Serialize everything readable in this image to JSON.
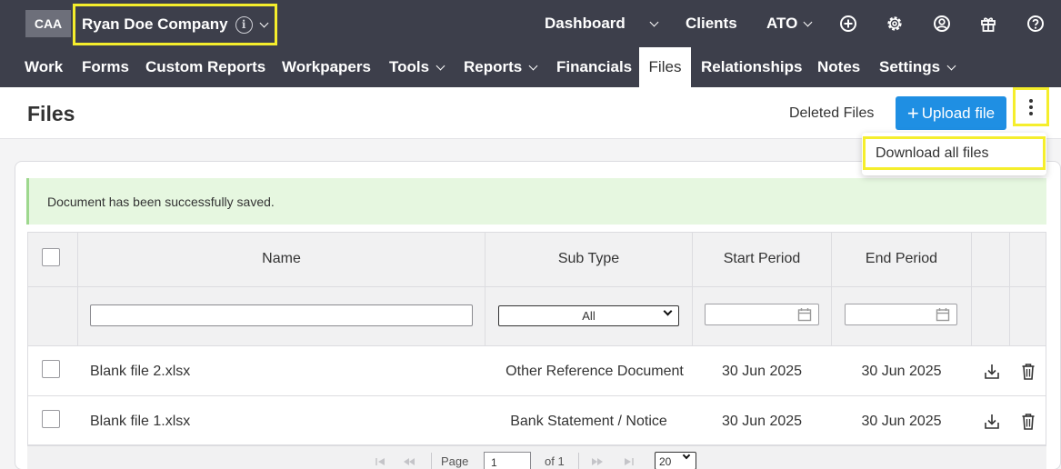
{
  "topbar": {
    "logo": "CAA",
    "company": "Ryan Doe Company",
    "company_info_glyph": "i",
    "dashboard": "Dashboard",
    "clients": "Clients",
    "ato": "ATO",
    "icons": [
      "plus-circle-icon",
      "gear-icon",
      "user-circle-icon",
      "gift-icon",
      "help-icon"
    ]
  },
  "nav": {
    "items": [
      {
        "label": "Work"
      },
      {
        "label": "Forms"
      },
      {
        "label": "Custom Reports"
      },
      {
        "label": "Workpapers"
      },
      {
        "label": "Tools"
      },
      {
        "label": "Reports"
      },
      {
        "label": "Financials"
      },
      {
        "label": "Files",
        "active": true
      },
      {
        "label": "Relationships"
      },
      {
        "label": "Notes"
      },
      {
        "label": "Settings"
      }
    ]
  },
  "header": {
    "title": "Files",
    "deleted_files": "Deleted Files",
    "upload_plus": "+",
    "upload": "Upload file"
  },
  "menu": {
    "download_all": "Download all files"
  },
  "alert": {
    "message": "Document has been successfully saved."
  },
  "table": {
    "columns": [
      "Name",
      "Sub Type",
      "Start Period",
      "End Period"
    ],
    "filter_subtype": "All",
    "rows": [
      {
        "name": "Blank file 2.xlsx",
        "sub_type": "Other Reference Document",
        "start": "30 Jun 2025",
        "end": "30 Jun 2025"
      },
      {
        "name": "Blank file 1.xlsx",
        "sub_type": "Bank Statement / Notice",
        "start": "30 Jun 2025",
        "end": "30 Jun 2025"
      }
    ]
  },
  "pager": {
    "page_label": "Page",
    "page_value": "1",
    "of_label": "of 1",
    "page_size": "20"
  },
  "colors": {
    "topbar": "#3d3f4b",
    "highlight": "#f5ee2c",
    "primary": "#1f8fe3",
    "alert_bg": "#e6f7e0"
  }
}
